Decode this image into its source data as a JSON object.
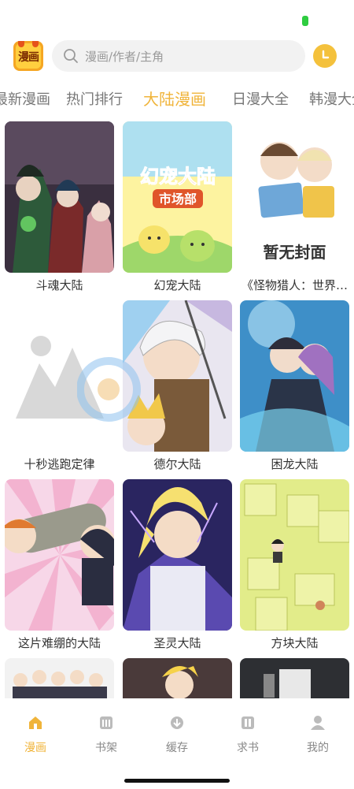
{
  "header": {
    "logo_text": "漫画",
    "search_placeholder": "漫画/作者/主角"
  },
  "tabs": [
    {
      "label": "最新漫画",
      "active": false
    },
    {
      "label": "热门排行",
      "active": false
    },
    {
      "label": "大陆漫画",
      "active": true
    },
    {
      "label": "日漫大全",
      "active": false
    },
    {
      "label": "韩漫大全",
      "active": false
    }
  ],
  "comics": [
    {
      "title": "斗魂大陆"
    },
    {
      "title": "幻宠大陆",
      "cover_title_line1": "幻宠大陆",
      "cover_title_line2": "市场部"
    },
    {
      "title": "《怪物猎人：世界…",
      "cover_placeholder": "暂无封面"
    },
    {
      "title": "十秒逃跑定律"
    },
    {
      "title": "德尔大陆"
    },
    {
      "title": "困龙大陆"
    },
    {
      "title": "这片难绷的大陆"
    },
    {
      "title": "圣灵大陆"
    },
    {
      "title": "方块大陆"
    }
  ],
  "bottom_nav": [
    {
      "label": "漫画",
      "icon": "home-icon",
      "active": true
    },
    {
      "label": "书架",
      "icon": "bookshelf-icon",
      "active": false
    },
    {
      "label": "缓存",
      "icon": "download-icon",
      "active": false
    },
    {
      "label": "求书",
      "icon": "book-request-icon",
      "active": false
    },
    {
      "label": "我的",
      "icon": "profile-icon",
      "active": false
    }
  ],
  "colors": {
    "accent": "#f0b43a",
    "status_battery": "#2ecc40",
    "inactive_text": "#777777"
  }
}
